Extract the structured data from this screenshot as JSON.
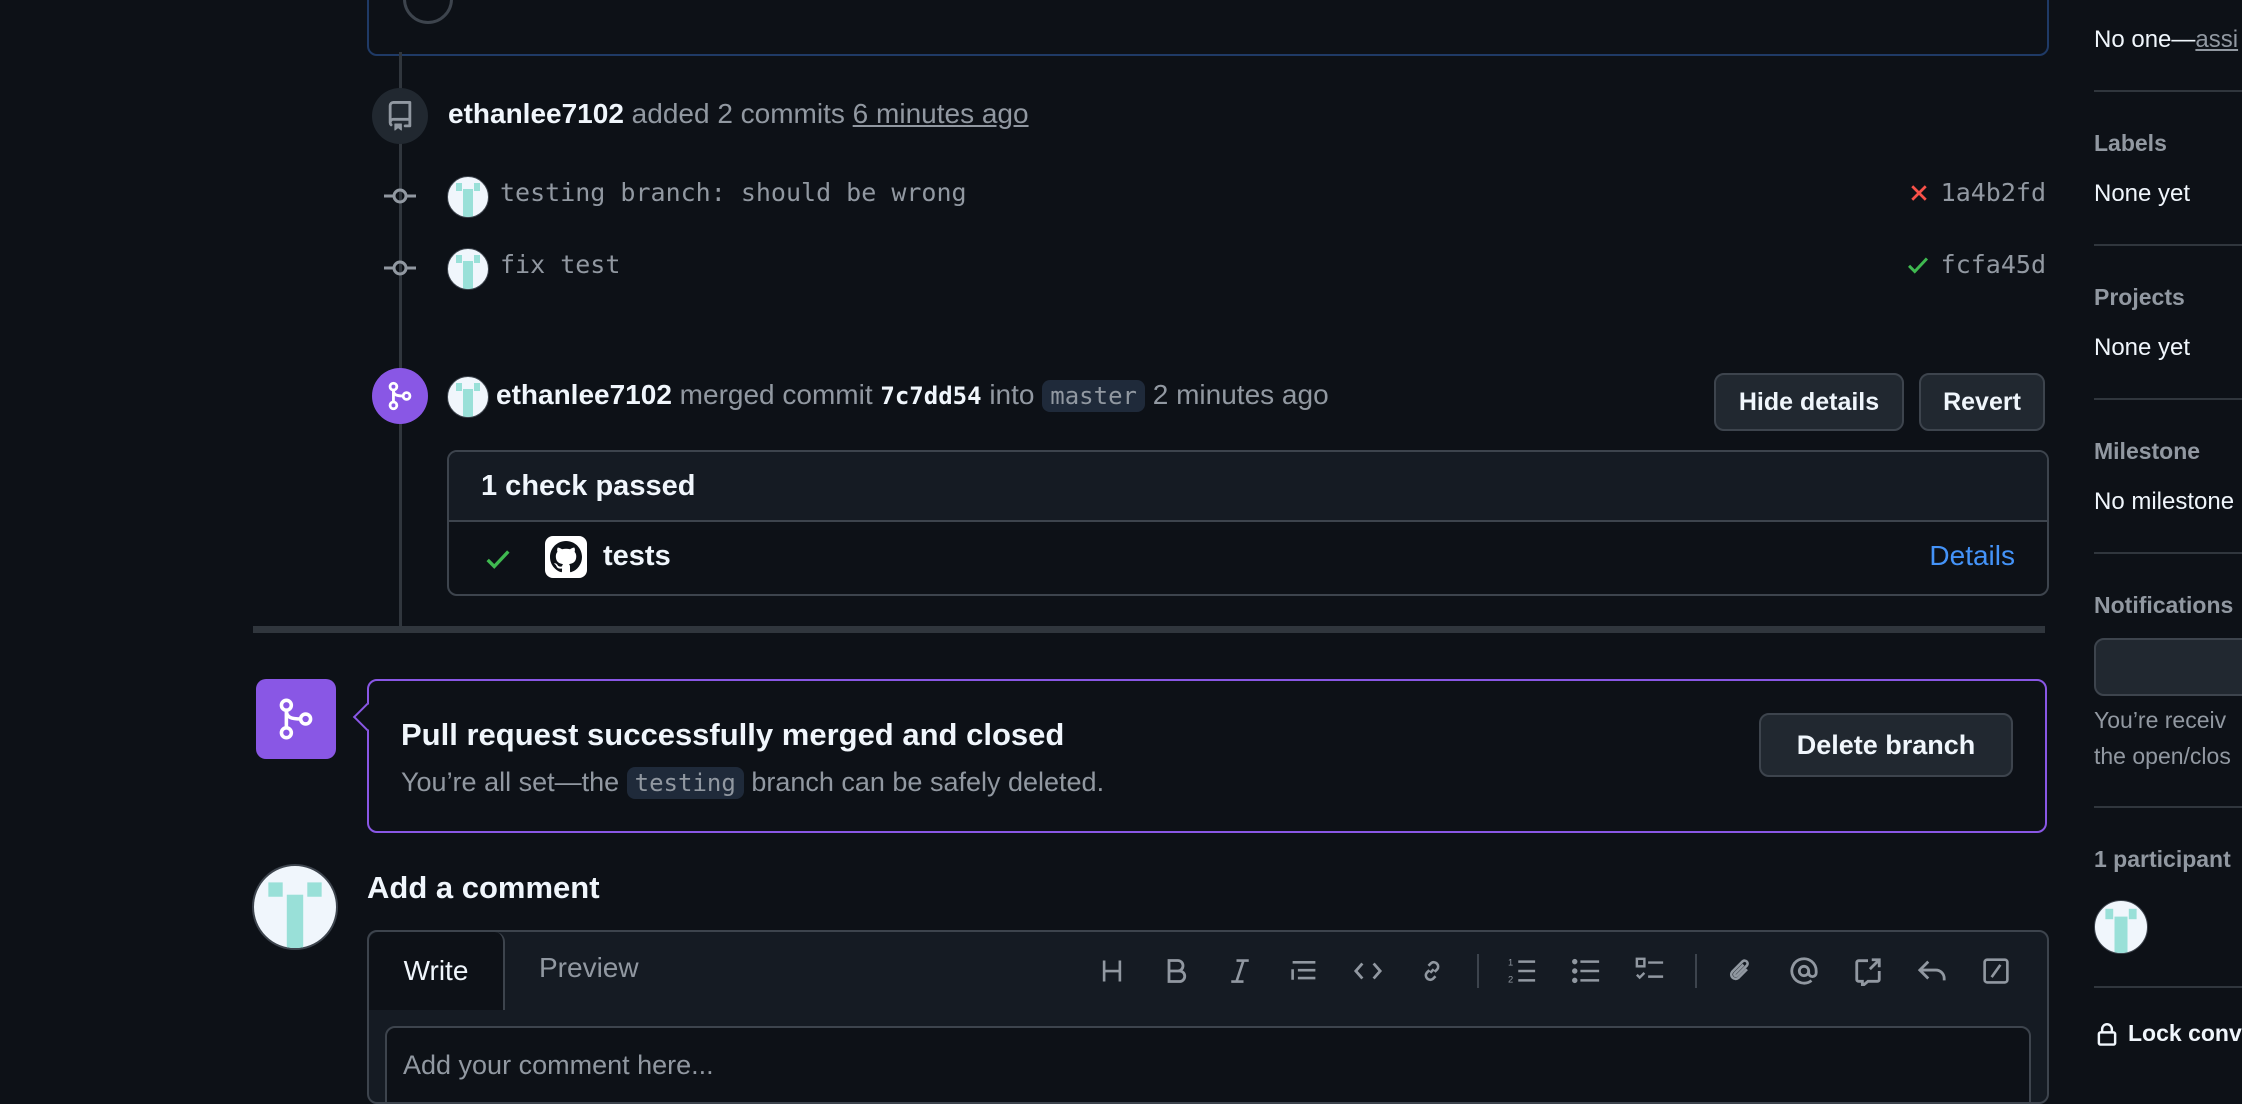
{
  "timeline": {
    "commits_event": {
      "author": "ethanlee7102",
      "action": "added 2 commits",
      "time": "6 minutes ago"
    },
    "commits": [
      {
        "message": "testing branch: should be wrong",
        "status": "failure",
        "sha": "1a4b2fd"
      },
      {
        "message": "fix test",
        "status": "success",
        "sha": "fcfa45d"
      }
    ],
    "merge_event": {
      "author": "ethanlee7102",
      "action": "merged commit",
      "commit": "7c7dd54",
      "into_word": "into",
      "branch": "master",
      "time": "2 minutes ago",
      "hide_details_label": "Hide details",
      "revert_label": "Revert"
    },
    "checks": {
      "header": "1 check passed",
      "items": [
        {
          "name": "tests",
          "details_label": "Details"
        }
      ]
    }
  },
  "merged_box": {
    "title": "Pull request successfully merged and closed",
    "desc_before": "You’re all set—the",
    "branch": "testing",
    "desc_after": "branch can be safely deleted.",
    "delete_label": "Delete branch"
  },
  "comment": {
    "heading": "Add a comment",
    "tab_write": "Write",
    "tab_preview": "Preview",
    "placeholder": "Add your comment here..."
  },
  "sidebar": {
    "assignees_value_prefix": "No one—",
    "assignees_link": "assi",
    "labels_title": "Labels",
    "labels_value": "None yet",
    "projects_title": "Projects",
    "projects_value": "None yet",
    "milestone_title": "Milestone",
    "milestone_value": "No milestone",
    "notifications_title": "Notifications",
    "notifications_line1": "You’re receiv",
    "notifications_line2": "the open/clos",
    "participants_title": "1 participant",
    "lock_label": "Lock conv"
  },
  "colors": {
    "accent_purple": "#8957e5",
    "success": "#3fb950",
    "danger": "#f85149",
    "link": "#4493f8"
  }
}
